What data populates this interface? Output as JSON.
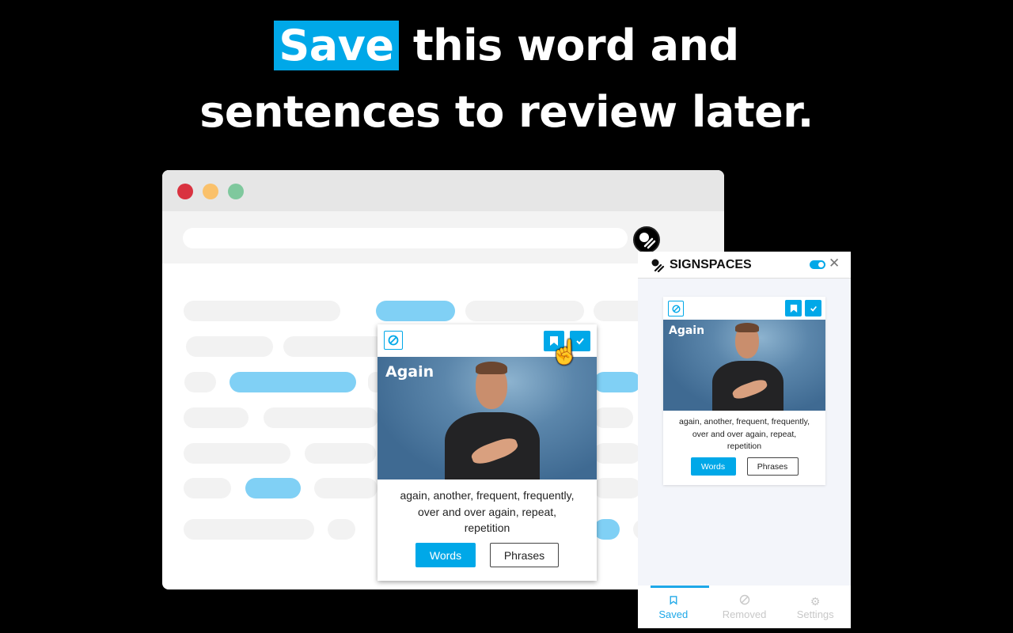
{
  "headline": {
    "line1_accent": "Save",
    "line1_rest": "this word and",
    "line2": "sentences to review later."
  },
  "colors": {
    "accent": "#00a8e8",
    "skeleton_blue": "#80d0f5",
    "skeleton_gray": "#f2f2f2"
  },
  "browser": {
    "window_controls": [
      "close",
      "minimize",
      "maximize"
    ],
    "extension_icon": "signspaces-logo-icon"
  },
  "popup_card": {
    "remove_icon": "block-icon",
    "save_icon": "bookmark-icon",
    "learned_icon": "check-icon",
    "word": "Again",
    "description": "again, another, frequent, frequently, over and over again, repeat, repetition",
    "buttons": [
      {
        "label": "Words",
        "active": true
      },
      {
        "label": "Phrases",
        "active": false
      }
    ],
    "cursor_icon": "hand-pointer-icon"
  },
  "side_panel": {
    "brand": "SIGNSPACES",
    "toggle_on": true,
    "close_icon": "close-icon",
    "card": {
      "word": "Again",
      "description": "again, another, frequent, frequently, over and over again, repeat, repetition",
      "buttons": [
        {
          "label": "Words",
          "active": true
        },
        {
          "label": "Phrases",
          "active": false
        }
      ]
    },
    "tabs": [
      {
        "label": "Saved",
        "icon": "bookmark-icon",
        "active": true
      },
      {
        "label": "Removed",
        "icon": "block-icon",
        "active": false
      },
      {
        "label": "Settings",
        "icon": "gear-icon",
        "active": false
      }
    ]
  }
}
